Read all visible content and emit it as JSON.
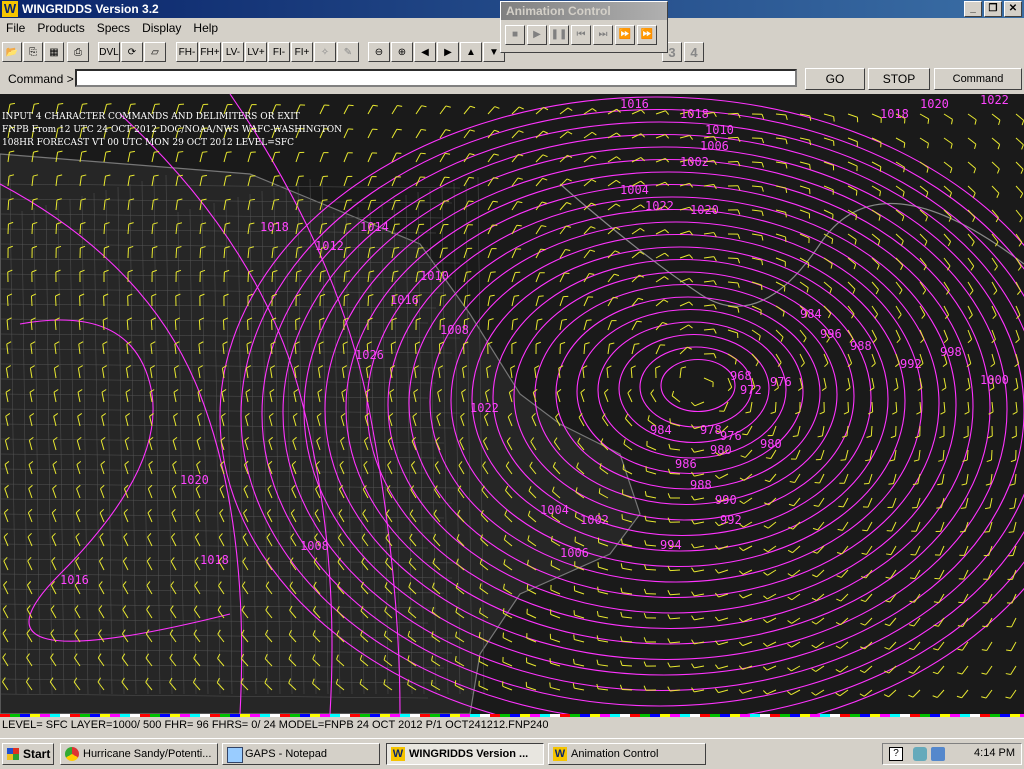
{
  "window": {
    "title": "WINGRIDDS Version 3.2"
  },
  "menu": [
    "File",
    "Products",
    "Specs",
    "Display",
    "Help"
  ],
  "toolbar": {
    "buttons": [
      "DVL",
      "FH-",
      "FH+",
      "LV-",
      "LV+",
      "FI-",
      "FI+"
    ],
    "page_numbers": [
      "3",
      "4"
    ]
  },
  "animation_control": {
    "title": "Animation Control"
  },
  "command": {
    "label": "Command >",
    "value": "",
    "go": "GO",
    "stop": "STOP",
    "history": "Command History"
  },
  "map": {
    "header": [
      "INPUT 4 CHARACTER COMMANDS AND DELIMITERS OR EXIT",
      "FNPB   From 12 UTC 24 OCT 2012   DOC/NOAA/NWS   WAFC-WASHINGTON",
      "108HR FORECAST   VT 00 UTC MON 29 OCT 2012   LEVEL=SFC"
    ],
    "pressure_labels": [
      "1016",
      "1018",
      "1010",
      "1006",
      "1002",
      "1004",
      "1022",
      "1020",
      "1018",
      "1012",
      "1014",
      "1010",
      "1016",
      "1008",
      "1026",
      "1022",
      "1020",
      "1018",
      "1008",
      "1004",
      "1002",
      "1006",
      "984",
      "980",
      "976",
      "972",
      "968",
      "976",
      "978",
      "980",
      "984",
      "986",
      "988",
      "990",
      "992",
      "994",
      "996",
      "988",
      "992",
      "998",
      "1000",
      "1020",
      "1022",
      "1018",
      "1016"
    ]
  },
  "status": "LEVEL= SFC LAYER=1000/ 500 FHR= 96 FHRS=  0/ 24 MODEL=FNPB  24 OCT 2012 P/1 OCT241212.FNP240",
  "taskbar": {
    "start": "Start",
    "tasks": [
      "Hurricane Sandy/Potenti...",
      "GAPS - Notepad",
      "WINGRIDDS Version ...",
      "Animation Control"
    ],
    "clock": "4:14 PM"
  }
}
